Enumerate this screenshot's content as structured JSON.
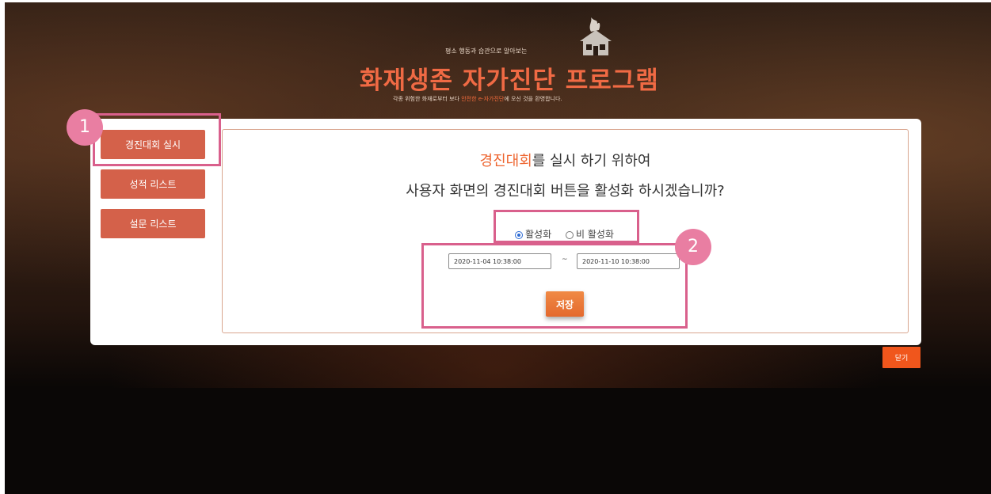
{
  "header": {
    "subtitle": "평소 행동과 습관으로 알아보는",
    "title": "화재생존 자가진단 프로그램",
    "tagline_prefix": "각종 위험한 화재로부터 보다 ",
    "tagline_highlight": "안전한 e-자가진단",
    "tagline_suffix": "에 오신 것을 환영합니다."
  },
  "sidebar": {
    "items": [
      {
        "label": "경진대회 실시"
      },
      {
        "label": "성적 리스트"
      },
      {
        "label": "설문 리스트"
      }
    ]
  },
  "main": {
    "question_accent": "경진대회",
    "question_rest": "를 실시 하기 위하여",
    "question_line2": "사용자 화면의 경진대회 버튼을 활성화 하시겠습니까?",
    "radio_options": [
      {
        "label": "활성화",
        "selected": true
      },
      {
        "label": "비 활성화",
        "selected": false
      }
    ],
    "start_date": "2020-11-04 10:38:00",
    "range_separator": "~",
    "end_date": "2020-11-10 10:38:00",
    "save_label": "저장"
  },
  "close_label": "닫기",
  "annotations": {
    "badge_1": "1",
    "badge_2": "2"
  },
  "colors": {
    "accent": "#ee6530",
    "sidebar_button": "#d4614a",
    "highlight": "#d9608c",
    "badge": "#e97ea2",
    "close_button": "#f0561c"
  }
}
